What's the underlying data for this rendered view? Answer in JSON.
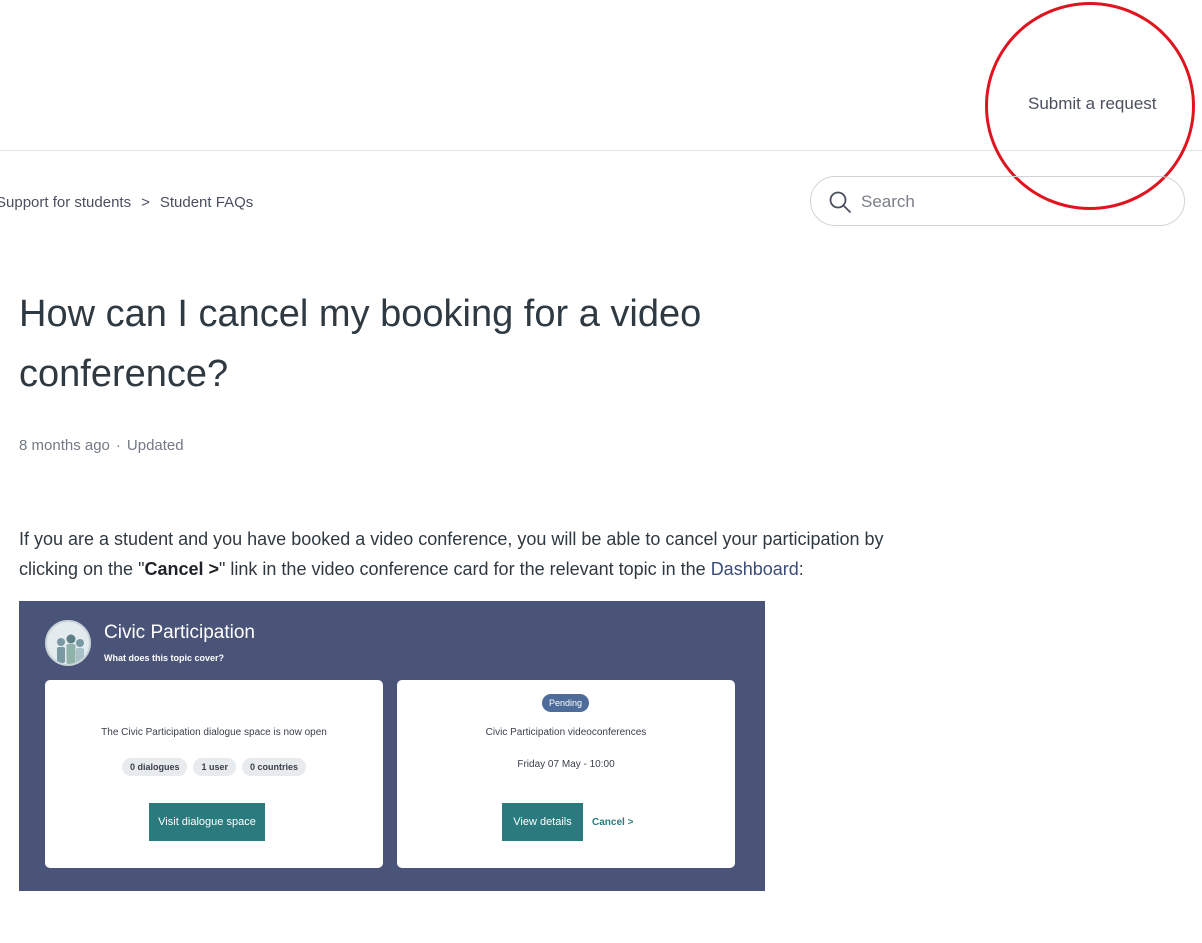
{
  "header": {
    "submit_request": "Submit a request"
  },
  "breadcrumb": {
    "items": [
      "Support for students",
      "Student FAQs"
    ],
    "separator": ">"
  },
  "search": {
    "placeholder": "Search"
  },
  "article": {
    "title": "How can I cancel my booking for a video conference?",
    "meta": {
      "age": "8 months ago",
      "separator": "·",
      "status": "Updated"
    },
    "body": {
      "part1": "If you are a student and you have booked a video conference, you will be able to cancel your participation by clicking on the \"",
      "bold": "Cancel >",
      "part2": "\" link in the video conference card for the relevant topic in the ",
      "link": "Dashboard",
      "part3": ":"
    }
  },
  "screenshot": {
    "topic_title": "Civic Participation",
    "topic_subtitle": "What does this topic cover?",
    "left_card": {
      "text": "The Civic Participation dialogue space is now open",
      "pills": [
        "0 dialogues",
        "1 user",
        "0 countries"
      ],
      "button": "Visit dialogue space"
    },
    "right_card": {
      "badge": "Pending",
      "title": "Civic Participation videoconferences",
      "date": "Friday 07 May - 10:00",
      "button": "View details",
      "cancel": "Cancel >"
    }
  },
  "colors": {
    "annotation": "#e0141f",
    "banner": "#4a5378",
    "teal_button": "#2a7a7e",
    "pending_badge": "#4e6c99",
    "link": "#3b4c7a"
  },
  "icons": {
    "search": "search-icon"
  }
}
